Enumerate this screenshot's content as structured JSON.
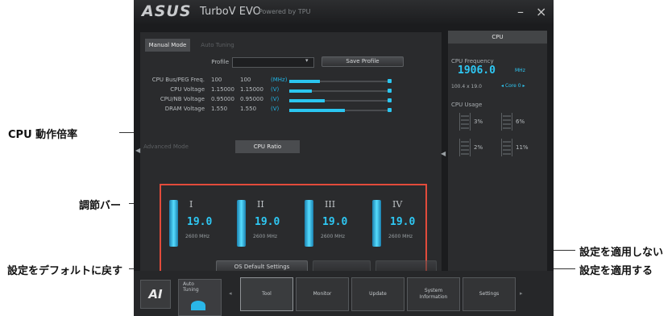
{
  "callouts": {
    "cpu_ratio": "CPU 動作倍率",
    "adjust_bar": "調節バー",
    "restore_default": "設定をデフォルトに戻す",
    "cancel": "設定を適用しない",
    "apply": "設定を適用する"
  },
  "window": {
    "logo": "ASUS",
    "title": "TurboV EVO",
    "subtitle": "Powered by TPU",
    "minimize": "–",
    "close": "×"
  },
  "mode_tabs": [
    "Manual Mode",
    "Auto Tuning"
  ],
  "profile": {
    "label": "Profile",
    "value": "",
    "save_button": "Save Profile"
  },
  "params": [
    {
      "label": "CPU Bus/PEG Freq.",
      "v1": "100",
      "v2": "100",
      "unit": "(MHz)",
      "level": 0.3
    },
    {
      "label": "CPU Voltage",
      "v1": "1.15000",
      "v2": "1.15000",
      "unit": "(V)",
      "level": 0.22
    },
    {
      "label": "CPU/NB Voltage",
      "v1": "0.95000",
      "v2": "0.95000",
      "unit": "(V)",
      "level": 0.35
    },
    {
      "label": "DRAM Voltage",
      "v1": "1.550",
      "v2": "1.550",
      "unit": "(V)",
      "level": 0.55
    }
  ],
  "sub_tabs": [
    "Advanced Mode",
    "CPU Ratio"
  ],
  "cores": [
    {
      "roman": "I",
      "ratio": "19.0",
      "freq": "2600 MHz"
    },
    {
      "roman": "II",
      "ratio": "19.0",
      "freq": "2600 MHz"
    },
    {
      "roman": "III",
      "ratio": "19.0",
      "freq": "2600 MHz"
    },
    {
      "roman": "IV",
      "ratio": "19.0",
      "freq": "2600 MHz"
    }
  ],
  "buttons": {
    "os_default": "OS Default Settings",
    "undo": "",
    "apply": ""
  },
  "cpu_panel": {
    "header": "CPU",
    "freq_label": "CPU Frequency",
    "freq_value": "1906.0",
    "freq_unit": "MHz",
    "freq_detail": "100.4 x 19.0",
    "core_selector": "Core 0",
    "usage_label": "CPU Usage",
    "usage": [
      "3%",
      "6%",
      "2%",
      "11%"
    ]
  },
  "bottom_nav": {
    "logo": "AI",
    "auto_tuning": [
      "Auto",
      "Tuning"
    ],
    "items": [
      "Tool",
      "Monitor",
      "Update",
      "System Information",
      "Settings"
    ]
  }
}
